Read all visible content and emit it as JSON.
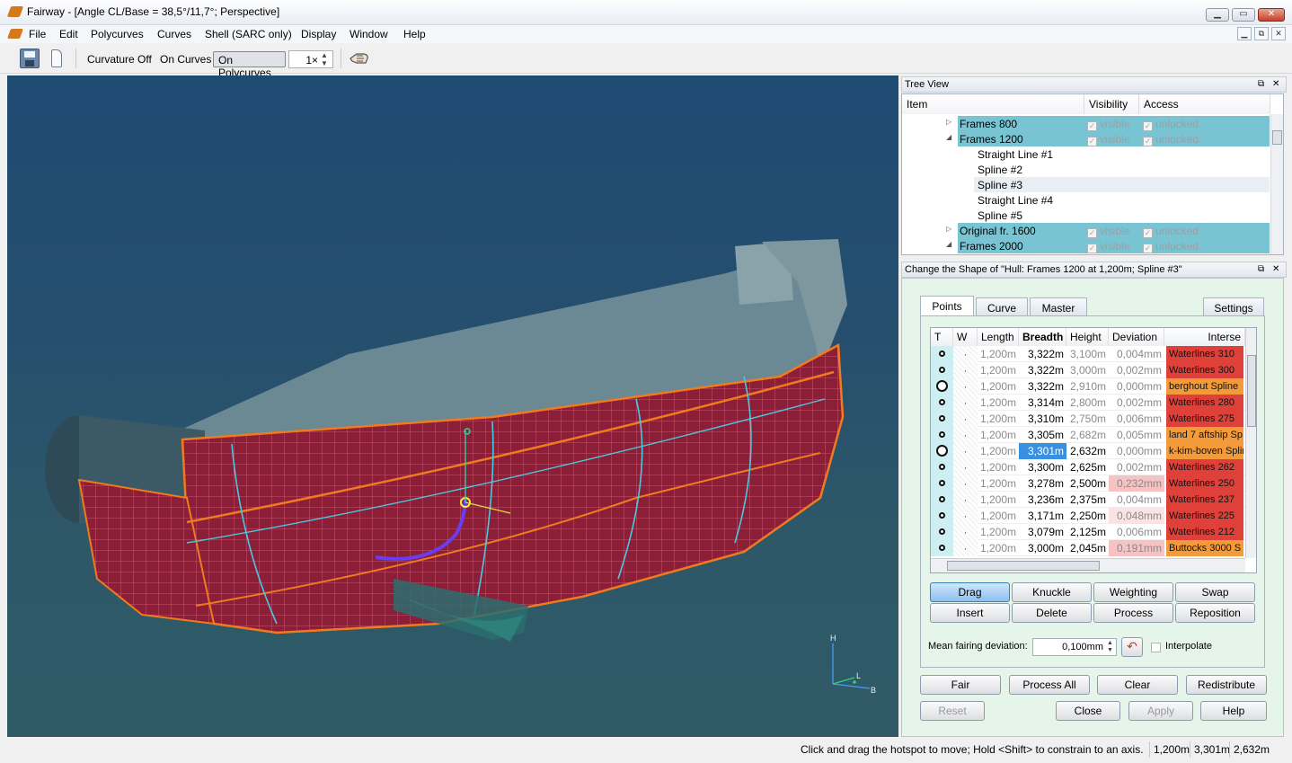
{
  "window": {
    "title": "Fairway - [Angle CL/Base = 38,5°/11,7°; Perspective]"
  },
  "menu": [
    "File",
    "Edit",
    "Polycurves",
    "Curves",
    "Shell (SARC only)",
    "Display",
    "Window",
    "Help"
  ],
  "toolbar": {
    "curvature": "Curvature Off",
    "on_curves": "On Curves",
    "on_polycurves": "On Polycurves",
    "multiplier": "1×"
  },
  "viewport": {
    "axis_h": "H",
    "axis_l": "L",
    "axis_b": "B"
  },
  "tree": {
    "title": "Tree View",
    "headers": [
      "Item",
      "Visibility",
      "Access"
    ],
    "rows": [
      {
        "label": "Frames    800",
        "vis": "visible",
        "acc": "unlocked",
        "selected": true,
        "expander": "▷"
      },
      {
        "label": "Frames    1200",
        "vis": "visible",
        "acc": "unlocked",
        "selected": true,
        "expander": "◢"
      },
      {
        "label": "Straight Line #1",
        "vis": "",
        "acc": "",
        "selected": false,
        "expander": ""
      },
      {
        "label": "Spline #2",
        "vis": "",
        "acc": "",
        "selected": false,
        "expander": ""
      },
      {
        "label": "Spline #3",
        "vis": "",
        "acc": "",
        "selected": false,
        "expander": ""
      },
      {
        "label": "Straight Line #4",
        "vis": "",
        "acc": "",
        "selected": false,
        "expander": ""
      },
      {
        "label": "Spline #5",
        "vis": "",
        "acc": "",
        "selected": false,
        "expander": ""
      },
      {
        "label": "Original fr. 1600",
        "vis": "visible",
        "acc": "unlocked",
        "selected": true,
        "expander": "▷"
      },
      {
        "label": "Frames    2000",
        "vis": "visible",
        "acc": "unlocked",
        "selected": true,
        "expander": "◢"
      }
    ]
  },
  "shape": {
    "title": "Change the Shape of \"Hull: Frames    1200 at 1,200m; Spline #3\"",
    "tabs": [
      "Points",
      "Curve",
      "Master",
      "Settings"
    ],
    "grid_headers": [
      "T",
      "W",
      "Length",
      "Breadth",
      "Height",
      "Deviation",
      "Interse"
    ],
    "rows": [
      {
        "t": "o",
        "w": "·",
        "len": "1,200m",
        "br": "3,322m",
        "h": "3,100m",
        "dev": "0,004mm",
        "int": "Waterlines    310",
        "ic": "#e0403a"
      },
      {
        "t": "o",
        "w": "·",
        "len": "1,200m",
        "br": "3,322m",
        "h": "3,000m",
        "dev": "0,002mm",
        "int": "Waterlines    300",
        "ic": "#e0403a"
      },
      {
        "t": "O",
        "w": "·",
        "len": "1,200m",
        "br": "3,322m",
        "h": "2,910m",
        "dev": "0,000mm",
        "int": "berghout Spline",
        "ic": "#f39a3a"
      },
      {
        "t": "o",
        "w": "·",
        "len": "1,200m",
        "br": "3,314m",
        "h": "2,800m",
        "dev": "0,002mm",
        "int": "Waterlines    280",
        "ic": "#e0403a"
      },
      {
        "t": "o",
        "w": "·",
        "len": "1,200m",
        "br": "3,310m",
        "h": "2,750m",
        "dev": "0,006mm",
        "int": "Waterlines    275",
        "ic": "#e0403a"
      },
      {
        "t": "o",
        "w": "·",
        "len": "1,200m",
        "br": "3,305m",
        "h": "2,682m",
        "dev": "0,005mm",
        "int": "land 7 aftship Sp",
        "ic": "#f39a3a"
      },
      {
        "t": "O",
        "w": "·",
        "len": "1,200m",
        "br": "3,301m",
        "h": "2,632m",
        "dev": "0,000mm",
        "int": "k-kim-boven Splin",
        "ic": "#f39a3a"
      },
      {
        "t": "o",
        "w": "·",
        "len": "1,200m",
        "br": "3,300m",
        "h": "2,625m",
        "dev": "0,002mm",
        "int": "Waterlines    262",
        "ic": "#e0403a"
      },
      {
        "t": "o",
        "w": "·",
        "len": "1,200m",
        "br": "3,278m",
        "h": "2,500m",
        "dev": "0,232mm",
        "int": "Waterlines    250",
        "ic": "#e0403a"
      },
      {
        "t": "o",
        "w": "·",
        "len": "1,200m",
        "br": "3,236m",
        "h": "2,375m",
        "dev": "0,004mm",
        "int": "Waterlines    237",
        "ic": "#e0403a"
      },
      {
        "t": "o",
        "w": "·",
        "len": "1,200m",
        "br": "3,171m",
        "h": "2,250m",
        "dev": "0,048mm",
        "int": "Waterlines    225",
        "ic": "#e0403a"
      },
      {
        "t": "o",
        "w": "·",
        "len": "1,200m",
        "br": "3,079m",
        "h": "2,125m",
        "dev": "0,006mm",
        "int": "Waterlines    212",
        "ic": "#e0403a"
      },
      {
        "t": "o",
        "w": "·",
        "len": "1,200m",
        "br": "3,000m",
        "h": "2,045m",
        "dev": "0,191mm",
        "int": "Buttocks    3000 S",
        "ic": "#f39a3a"
      }
    ],
    "buttons_row1": [
      "Drag",
      "Knuckle",
      "Weighting",
      "Swap"
    ],
    "buttons_row2": [
      "Insert",
      "Delete",
      "Process",
      "Reposition"
    ],
    "mean_label": "Mean fairing deviation:",
    "mean_value": "0,100mm",
    "interpolate": "Interpolate",
    "bottom1": [
      "Fair",
      "Process All",
      "Clear",
      "Redistribute"
    ],
    "bottom2": [
      "Reset",
      "Close",
      "Apply",
      "Help"
    ]
  },
  "status": {
    "message": "Click and drag the hotspot to move; Hold <Shift> to constrain to an axis.",
    "l": "1,200m",
    "b": "3,301m",
    "h": "2,632m"
  }
}
